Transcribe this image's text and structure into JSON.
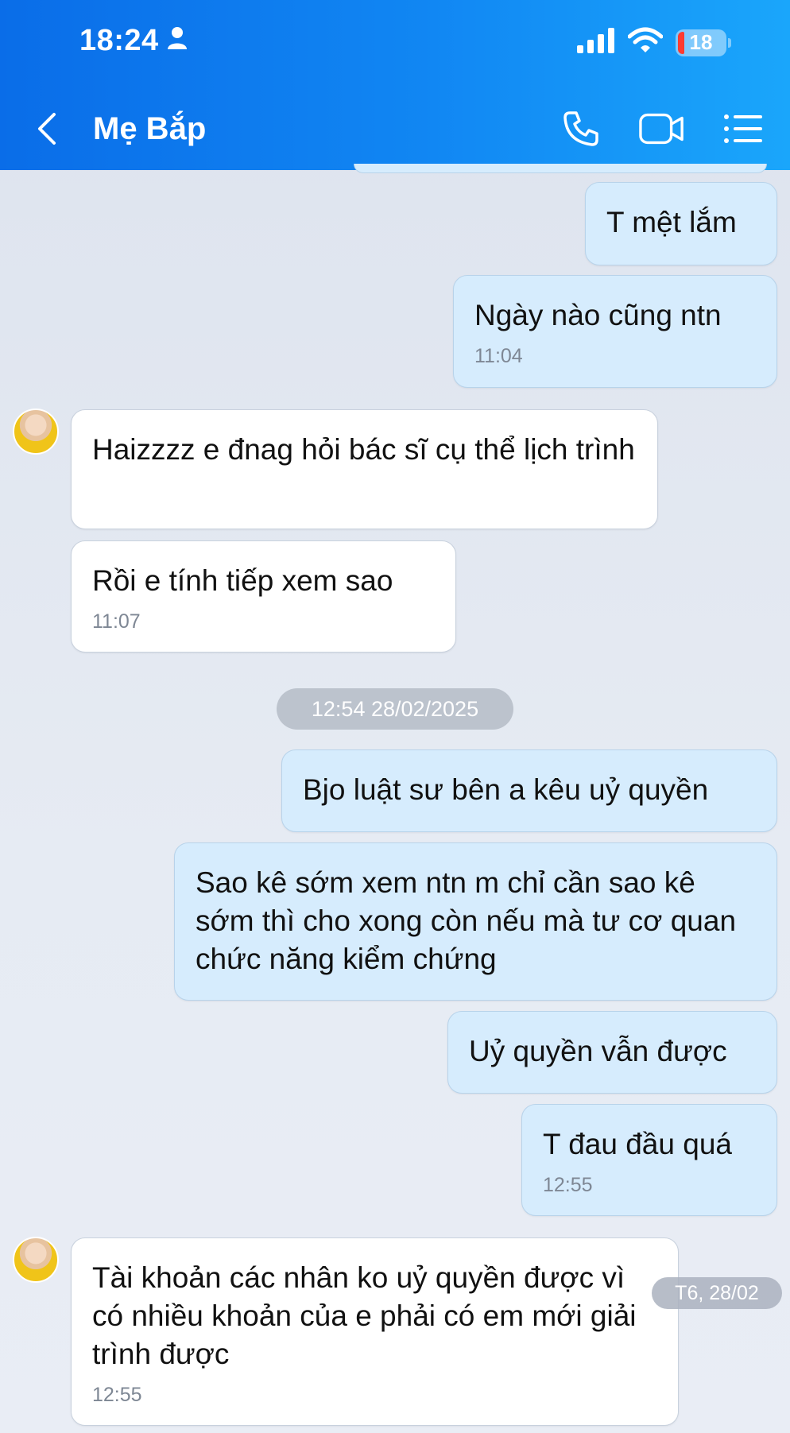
{
  "status_bar": {
    "time": "18:24",
    "battery": "18",
    "icons": [
      "person-icon",
      "signal-icon",
      "wifi-icon",
      "battery-icon"
    ]
  },
  "header": {
    "title": "Mẹ Bắp",
    "icons": [
      "back-icon",
      "phone-icon",
      "video-call-icon",
      "menu-icon"
    ]
  },
  "colors": {
    "header_start": "#0a6de8",
    "header_end": "#1aa6fb",
    "sent_bubble": "#d6ecfd",
    "received_bubble": "#ffffff",
    "background": "#e4e9f1"
  },
  "messages": [
    {
      "side": "sent",
      "text": "T mệt lắm",
      "time": ""
    },
    {
      "side": "sent",
      "text": "Ngày nào cũng ntn",
      "time": "11:04"
    },
    {
      "side": "received",
      "text": "Haizzzz e đnag hỏi bác sĩ cụ thể lịch trình",
      "time": ""
    },
    {
      "side": "received",
      "text": "Rồi e tính tiếp xem sao",
      "time": "11:07"
    },
    {
      "side": "sent",
      "text": "Bjo luật sư bên a kêu uỷ quyền",
      "time": ""
    },
    {
      "side": "sent",
      "text": "Sao kê sớm xem ntn m chỉ cần sao kê sớm thì cho xong còn nếu mà tư cơ quan chức năng kiểm chứng",
      "time": ""
    },
    {
      "side": "sent",
      "text": "Uỷ quyền vẫn được",
      "time": ""
    },
    {
      "side": "sent",
      "text": "T đau đầu quá",
      "time": "12:55"
    },
    {
      "side": "received",
      "text": "Tài khoản các nhân ko uỷ quyền được vì có nhiều khoản của e phải có em mới giải trình được",
      "time": "12:55"
    }
  ],
  "date_divider": "12:54 28/02/2025",
  "floating_date": "T6, 28/02"
}
